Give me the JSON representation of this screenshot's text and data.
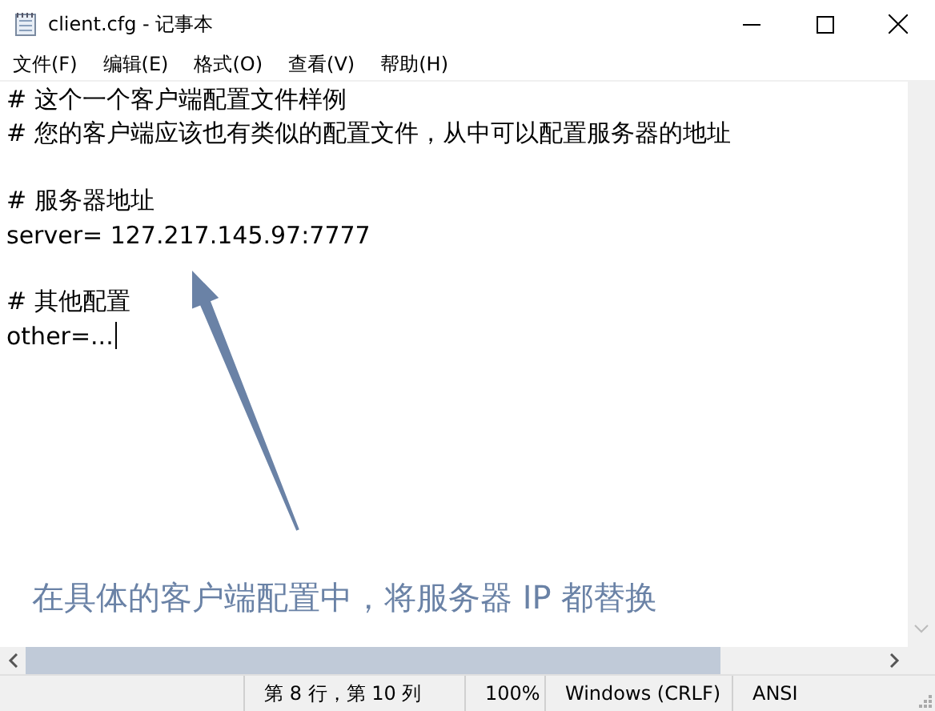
{
  "window": {
    "title": "client.cfg - 记事本"
  },
  "menu": [
    "文件(F)",
    "编辑(E)",
    "格式(O)",
    "查看(V)",
    "帮助(H)"
  ],
  "lines": [
    {
      "kind": "text",
      "text": "# 这个一个客户端配置文件样例",
      "caret": false
    },
    {
      "kind": "text",
      "text": "# 您的客户端应该也有类似的配置文件，从中可以配置服务器的地址",
      "caret": false
    },
    {
      "kind": "blank"
    },
    {
      "kind": "text",
      "text": "# 服务器地址",
      "caret": false
    },
    {
      "kind": "text",
      "text": "server= 127.217.145.97:7777",
      "caret": false
    },
    {
      "kind": "blank"
    },
    {
      "kind": "text",
      "text": "# 其他配置",
      "caret": false
    },
    {
      "kind": "text",
      "text": "other=...",
      "caret": true
    }
  ],
  "annotation": {
    "text": "在具体的客户端配置中，将服务器 IP 都替换"
  },
  "status_bar": [
    "第 8 行，第 10 列",
    "100%",
    "Windows (CRLF)",
    "ANSI"
  ]
}
